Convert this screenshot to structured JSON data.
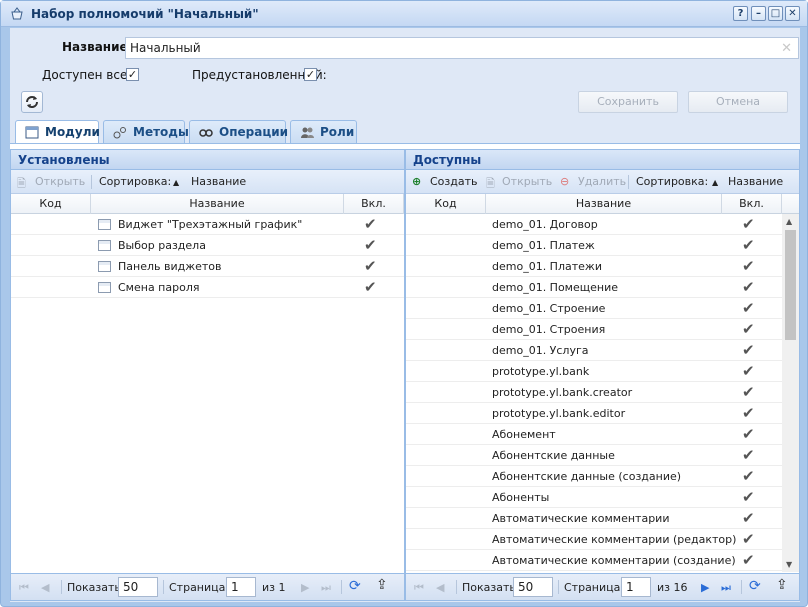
{
  "window": {
    "title": "Набор полномочий \"Начальный\"",
    "tools": [
      "?",
      "–",
      "□",
      "✕"
    ]
  },
  "form": {
    "name_label": "Название:",
    "name_value": "Начальный",
    "available_label": "Доступен всем:",
    "preset_label": "Предустановленный:",
    "save_label": "Сохранить",
    "cancel_label": "Отмена"
  },
  "tabs": [
    {
      "label": "Модули",
      "active": true
    },
    {
      "label": "Методы",
      "active": false
    },
    {
      "label": "Операции",
      "active": false
    },
    {
      "label": "Роли",
      "active": false
    }
  ],
  "left": {
    "title": "Установлены",
    "open_label": "Открыть",
    "sort_label": "Сортировка:",
    "sort_field": "Название",
    "columns": {
      "code": "Код",
      "name": "Название",
      "on": "Вкл."
    },
    "rows": [
      {
        "name": "Виджет \"Трехэтажный график\""
      },
      {
        "name": "Выбор раздела"
      },
      {
        "name": "Панель виджетов"
      },
      {
        "name": "Смена пароля"
      }
    ],
    "pager": {
      "show_label": "Показать",
      "show_value": "50",
      "page_label": "Страница",
      "page_value": "1",
      "of_label": "из 1"
    }
  },
  "right": {
    "title": "Доступны",
    "create_label": "Создать",
    "open_label": "Открыть",
    "delete_label": "Удалить",
    "sort_label": "Сортировка:",
    "sort_field": "Название",
    "columns": {
      "code": "Код",
      "name": "Название",
      "on": "Вкл."
    },
    "rows": [
      {
        "name": "demo_01. Договор"
      },
      {
        "name": "demo_01. Платеж"
      },
      {
        "name": "demo_01. Платежи"
      },
      {
        "name": "demo_01. Помещение"
      },
      {
        "name": "demo_01. Строение"
      },
      {
        "name": "demo_01. Строения"
      },
      {
        "name": "demo_01. Услуга"
      },
      {
        "name": "prototype.yl.bank"
      },
      {
        "name": "prototype.yl.bank.creator"
      },
      {
        "name": "prototype.yl.bank.editor"
      },
      {
        "name": "Абонемент"
      },
      {
        "name": "Абонентские данные"
      },
      {
        "name": "Абонентские данные (создание)"
      },
      {
        "name": "Абоненты"
      },
      {
        "name": "Автоматические комментарии"
      },
      {
        "name": "Автоматические комментарии (редактор)"
      },
      {
        "name": "Автоматические комментарии (создание)"
      }
    ],
    "pager": {
      "show_label": "Показать",
      "show_value": "50",
      "page_label": "Страница",
      "page_value": "1",
      "of_label": "из 16"
    }
  },
  "icons": {
    "check": "✔",
    "sort_arrow": "▲"
  }
}
